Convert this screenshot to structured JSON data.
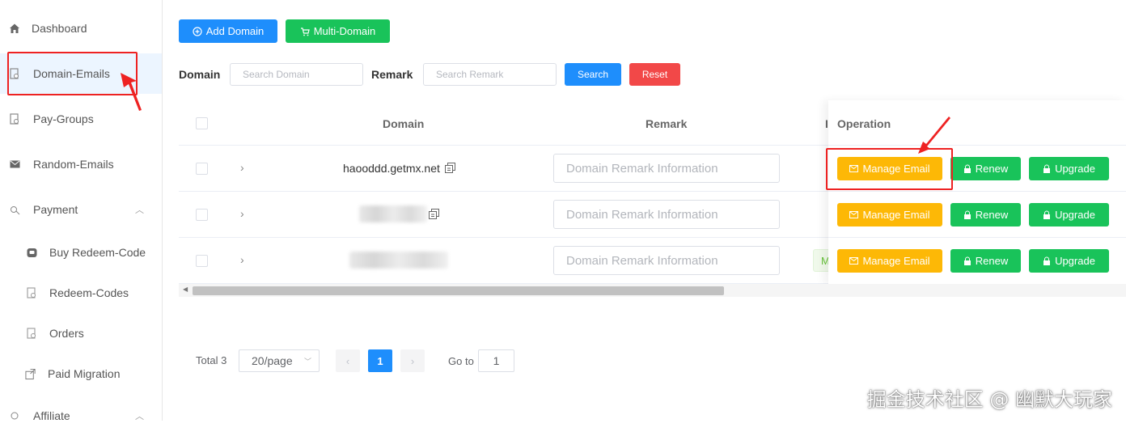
{
  "sidebar": {
    "items": [
      {
        "label": "Dashboard",
        "icon": "home-icon"
      },
      {
        "label": "Domain-Emails",
        "icon": "domain-icon"
      },
      {
        "label": "Pay-Groups",
        "icon": "group-icon"
      },
      {
        "label": "Random-Emails",
        "icon": "mail-icon"
      },
      {
        "label": "Payment",
        "icon": "payment-icon"
      },
      {
        "label": "Buy Redeem-Code",
        "icon": "cart-icon"
      },
      {
        "label": "Redeem-Codes",
        "icon": "code-icon"
      },
      {
        "label": "Orders",
        "icon": "orders-icon"
      },
      {
        "label": "Paid Migration",
        "icon": "migration-icon"
      },
      {
        "label": "Affiliate",
        "icon": "affiliate-icon"
      }
    ]
  },
  "toolbar": {
    "add_domain": "Add Domain",
    "multi_domain": "Multi-Domain"
  },
  "filters": {
    "domain_label": "Domain",
    "domain_placeholder": "Search Domain",
    "remark_label": "Remark",
    "remark_placeholder": "Search Remark",
    "search": "Search",
    "reset": "Reset"
  },
  "table": {
    "headers": {
      "domain": "Domain",
      "remark": "Remark",
      "status_partial": "I",
      "operation": "Operation"
    },
    "rows": [
      {
        "domain": "haooddd.getmx.net",
        "remark_placeholder": "Domain Remark Information",
        "status_partial": ""
      },
      {
        "domain": "",
        "remark_placeholder": "Domain Remark Information",
        "status_partial": ""
      },
      {
        "domain": "",
        "remark_placeholder": "Domain Remark Information",
        "status_partial": "M"
      }
    ],
    "actions": {
      "manage": "Manage Email",
      "renew": "Renew",
      "upgrade": "Upgrade"
    }
  },
  "pagination": {
    "total": "Total 3",
    "page_size": "20/page",
    "current_page": "1",
    "goto_label": "Go to",
    "goto_value": "1"
  },
  "watermark": "掘金技术社区 @ 幽默大玩家",
  "colors": {
    "primary": "#1e8efc",
    "success": "#19c35a",
    "danger": "#f24848",
    "warning": "#fdb806",
    "highlight": "#e22222"
  }
}
